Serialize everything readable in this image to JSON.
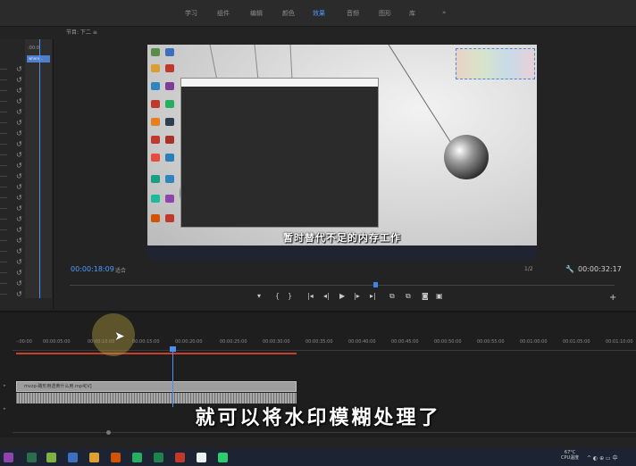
{
  "workspace_tabs": [
    {
      "label": "学习",
      "active": false
    },
    {
      "label": "组件",
      "active": false
    },
    {
      "label": "编辑",
      "active": false
    },
    {
      "label": "颜色",
      "active": false
    },
    {
      "label": "效果",
      "active": true
    },
    {
      "label": "音频",
      "active": false
    },
    {
      "label": "图形",
      "active": false
    },
    {
      "label": "库",
      "active": false
    },
    {
      "label": "»",
      "active": false
    }
  ],
  "accent_color": "#4d9bff",
  "left_panel": {
    "mini_timecode": ":00:0",
    "mini_clip_label": "where..."
  },
  "program_monitor": {
    "title": "节目: 下二 ≡",
    "subtitle_in_video": "暂时替代不足的内存工作",
    "timecode_current": "00:00:18:09",
    "fit_label": "适合",
    "quality_label": "1/2",
    "timecode_duration": "00:00:32:17",
    "controls": [
      "▾",
      "{",
      "}",
      "|◂",
      "◂|",
      "▶",
      "|▸",
      "▸|",
      "⧉",
      "⧉",
      "◙",
      "▣"
    ],
    "add_label": "+"
  },
  "timeline": {
    "ruler_labels": [
      "-:00:00",
      "00:00:05:00",
      "00:00:10:00",
      "00:00:15:00",
      "00:00:20:00",
      "00:00:25:00",
      "00:00:30:00",
      "00:00:35:00",
      "00:00:40:00",
      "00:00:45:00",
      "00:00:50:00",
      "00:00:55:00",
      "00:01:00:00",
      "00:01:05:00",
      "00:01:10:00"
    ],
    "video_clip_label": "mvzp-路形用透黄什么用.mp4[V]",
    "track_v": "▸",
    "track_a": "▸"
  },
  "caption": "就可以将水印模糊处理了",
  "taskbar": {
    "temp": "67°C",
    "cpu": "CPU温度",
    "tray": "^ ◐ ⊕ ▭ 中"
  }
}
